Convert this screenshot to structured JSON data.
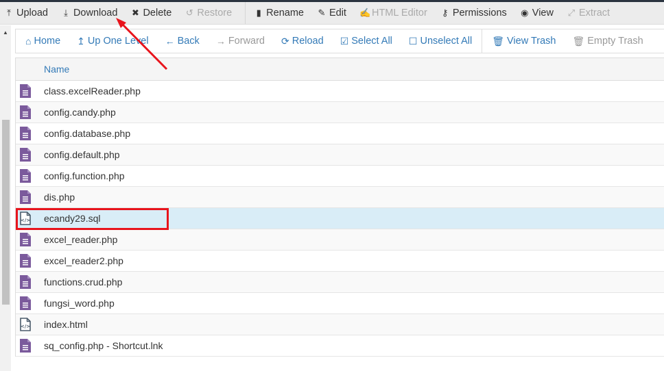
{
  "toolbar": {
    "items": [
      {
        "label": "Upload",
        "icon": "upload-icon",
        "disabled": false
      },
      {
        "label": "Download",
        "icon": "download-icon",
        "disabled": false
      },
      {
        "label": "Delete",
        "icon": "close-icon",
        "disabled": false
      },
      {
        "label": "Restore",
        "icon": "undo-icon",
        "disabled": true
      },
      {
        "label": "Rename",
        "icon": "file-icon",
        "disabled": false
      },
      {
        "label": "Edit",
        "icon": "pencil-icon",
        "disabled": false
      },
      {
        "label": "HTML Editor",
        "icon": "edit-square-icon",
        "disabled": true
      },
      {
        "label": "Permissions",
        "icon": "key-icon",
        "disabled": false
      },
      {
        "label": "View",
        "icon": "eye-icon",
        "disabled": false
      },
      {
        "label": "Extract",
        "icon": "expand-icon",
        "disabled": true
      }
    ]
  },
  "nav": {
    "items": [
      {
        "label": "Home",
        "icon": "home-icon",
        "disabled": false
      },
      {
        "label": "Up One Level",
        "icon": "level-up-icon",
        "disabled": false
      },
      {
        "label": "Back",
        "icon": "arrow-left-icon",
        "disabled": false
      },
      {
        "label": "Forward",
        "icon": "arrow-right-icon",
        "disabled": true
      },
      {
        "label": "Reload",
        "icon": "refresh-icon",
        "disabled": false
      },
      {
        "label": "Select All",
        "icon": "checkbox-checked-icon",
        "disabled": false
      },
      {
        "label": "Unselect All",
        "icon": "checkbox-empty-icon",
        "disabled": false
      },
      {
        "label": "View Trash",
        "icon": "trash-icon",
        "disabled": false
      },
      {
        "label": "Empty Trash",
        "icon": "trash-icon",
        "disabled": true
      }
    ]
  },
  "table": {
    "header": "Name",
    "files": [
      {
        "name": "class.excelReader.php",
        "type": "text"
      },
      {
        "name": "config.candy.php",
        "type": "text"
      },
      {
        "name": "config.database.php",
        "type": "text"
      },
      {
        "name": "config.default.php",
        "type": "text"
      },
      {
        "name": "config.function.php",
        "type": "text"
      },
      {
        "name": "dis.php",
        "type": "text"
      },
      {
        "name": "ecandy29.sql",
        "type": "code",
        "selected": true
      },
      {
        "name": "excel_reader.php",
        "type": "text"
      },
      {
        "name": "excel_reader2.php",
        "type": "text"
      },
      {
        "name": "functions.crud.php",
        "type": "text"
      },
      {
        "name": "fungsi_word.php",
        "type": "text"
      },
      {
        "name": "index.html",
        "type": "code"
      },
      {
        "name": "sq_config.php - Shortcut.lnk",
        "type": "text"
      }
    ]
  },
  "colors": {
    "link": "#337ab7",
    "file_icon": "#7b5a9c",
    "code_icon": "#4a5a6a",
    "selected_row": "#d9edf7",
    "annotation": "#e8141c"
  }
}
